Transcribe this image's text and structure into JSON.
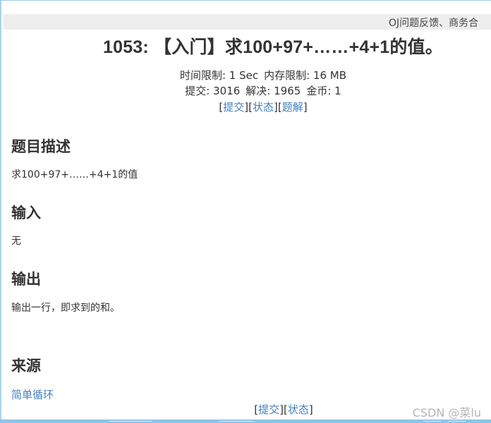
{
  "notice": {
    "text": "OJ问题反馈、商务合"
  },
  "problem": {
    "title": "1053: 【入门】求100+97+……+4+1的值。",
    "time_limit_label": "时间限制:",
    "time_limit_value": "1 Sec",
    "memory_limit_label": "内存限制:",
    "memory_limit_value": "16 MB",
    "submit_count_label": "提交:",
    "submit_count_value": "3016",
    "solved_label": "解决:",
    "solved_value": "1965",
    "coin_label": "金币:",
    "coin_value": "1"
  },
  "links": {
    "submit": "提交",
    "status": "状态",
    "solution": "题解"
  },
  "sections": {
    "description_title": "题目描述",
    "description_text": "求100+97+……+4+1的值",
    "input_title": "输入",
    "input_text": "无",
    "output_title": "输出",
    "output_text": "输出一行，即求到的和。",
    "source_title": "来源",
    "source_link": "简单循环"
  },
  "bottom_links": {
    "submit": "提交",
    "status": "状态"
  },
  "watermark": {
    "text": "CSDN @菜lu"
  },
  "colors": {
    "link": "#3f7fbf",
    "text": "#333333",
    "notice_bg": "#eeeeee",
    "frame": "#8ec4ea"
  }
}
